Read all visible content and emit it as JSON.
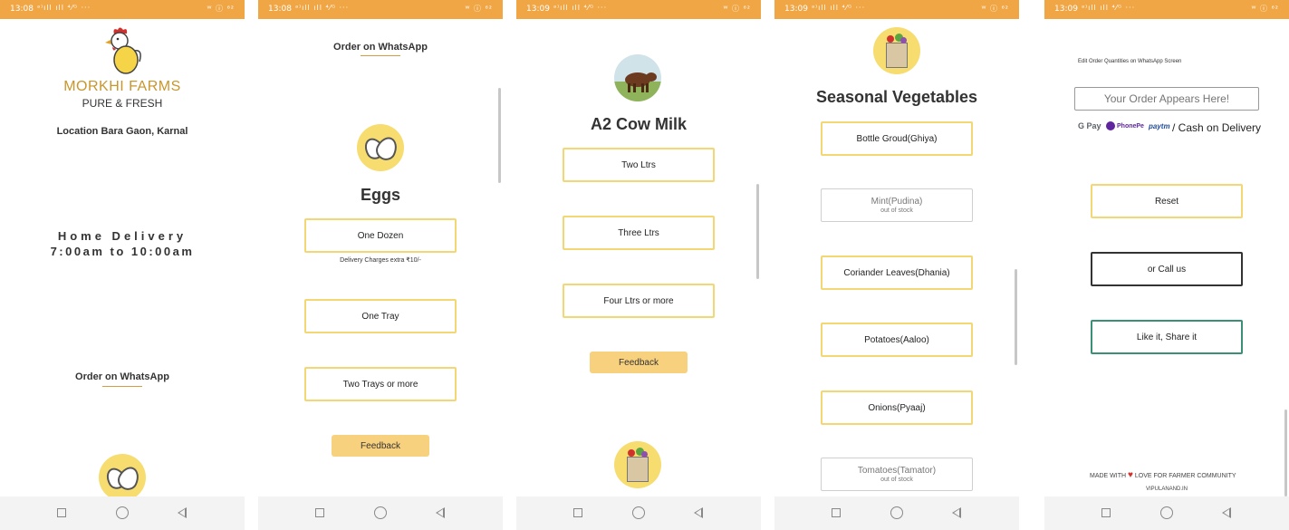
{
  "status_bar": {
    "times": [
      "13:08",
      "13:08",
      "13:09",
      "13:09",
      "13:09"
    ],
    "signal": "ᵃ⁾ıll ıll ⁴⁄ᴳ ···",
    "right": "ᵂ ⓘ ⁶²"
  },
  "screen1": {
    "brand_name": "MORKHI FARMS",
    "tagline": "PURE & FRESH",
    "location": "Location Bara Gaon, Karnal",
    "delivery_line1": "Home Delivery",
    "delivery_line2": "7:00am to 10:00am",
    "order_link": "Order on WhatsApp"
  },
  "screen2": {
    "order_link": "Order on WhatsApp",
    "title": "Eggs",
    "options": [
      "One Dozen",
      "One Tray",
      "Two Trays or more"
    ],
    "delivery_note": "Delivery Charges extra ₹10/-",
    "feedback": "Feedback"
  },
  "screen3": {
    "title": "A2 Cow Milk",
    "options": [
      "Two Ltrs",
      "Three Ltrs",
      "Four Ltrs or more"
    ],
    "feedback": "Feedback"
  },
  "screen4": {
    "title": "Seasonal Vegetables",
    "options": [
      {
        "label": "Bottle Groud(Ghiya)",
        "sub": ""
      },
      {
        "label": "Mint(Pudina)",
        "sub": "out of stock"
      },
      {
        "label": "Coriander Leaves(Dhania)",
        "sub": ""
      },
      {
        "label": "Potatoes(Aaloo)",
        "sub": ""
      },
      {
        "label": "Onions(Pyaaj)",
        "sub": ""
      },
      {
        "label": "Tomatoes(Tamator)",
        "sub": "out of stock"
      }
    ]
  },
  "screen5": {
    "hint": "Edit Order Quantities on WhatsApp Screen",
    "order_placeholder": "Your Order Appears Here!",
    "payments": {
      "gpay": "G Pay",
      "phonepe": "PhonePe",
      "paytm": "paytm",
      "suffix": "/ Cash on Delivery"
    },
    "reset": "Reset",
    "call": "or Call us",
    "share": "Like it, Share it",
    "footer_left": "MADE WITH",
    "footer_right": "LOVE FOR FARMER COMMUNITY",
    "site": "VIPULANAND.IN"
  },
  "colors": {
    "status_bar": "#f0a644",
    "button_border": "#f3d774",
    "feedback_bg": "#f8d17f",
    "share_border": "#3a8f77",
    "heart": "#d0312d"
  }
}
